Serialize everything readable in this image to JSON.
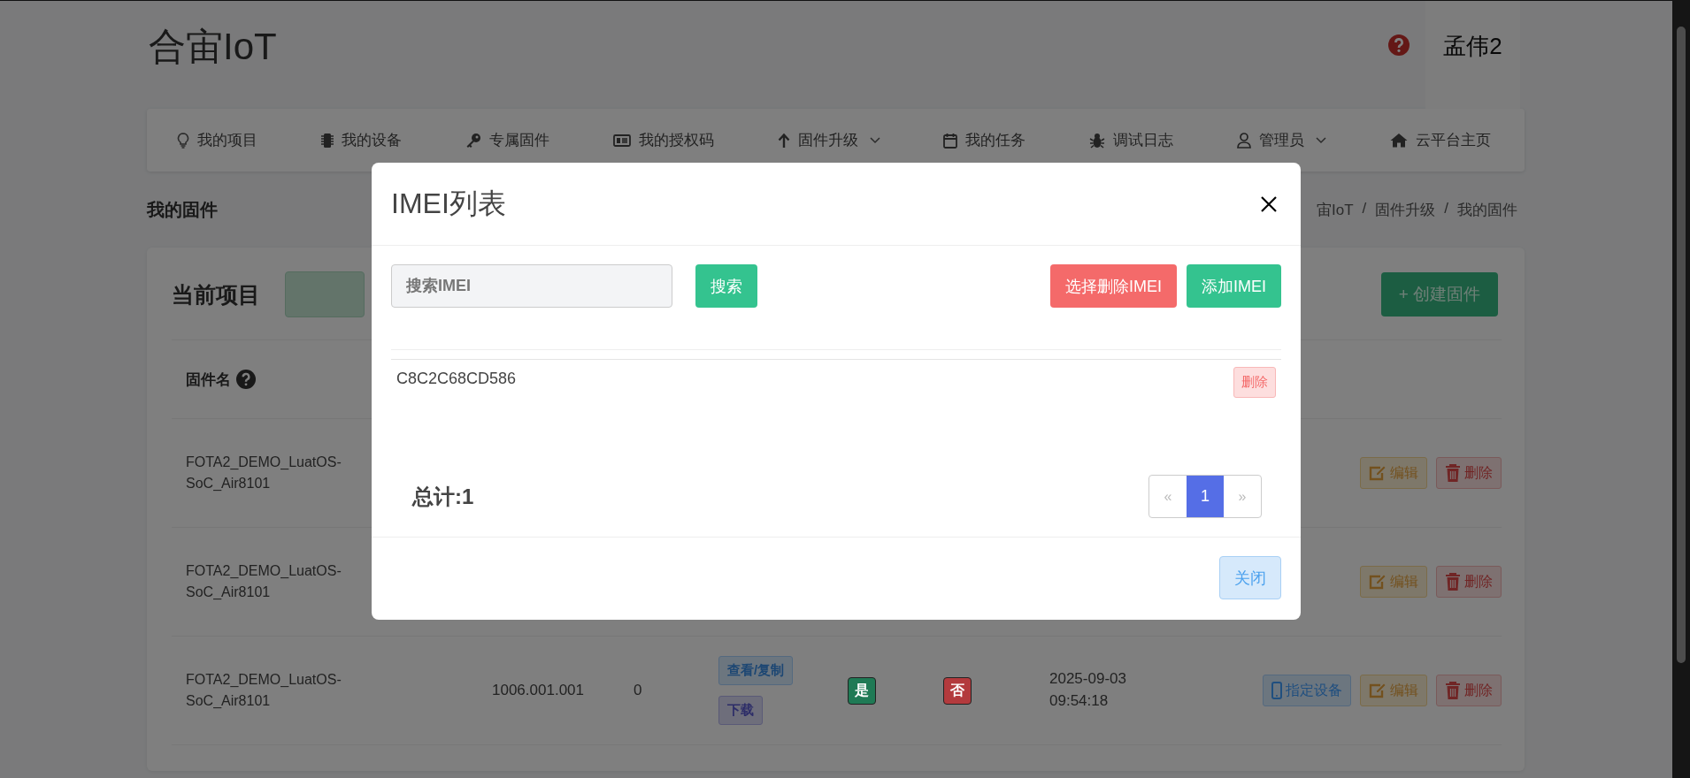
{
  "header": {
    "logo": "合宙IoT",
    "user": "孟伟2"
  },
  "nav": [
    {
      "label": "我的项目",
      "dropdown": false
    },
    {
      "label": "我的设备",
      "dropdown": false
    },
    {
      "label": "专属固件",
      "dropdown": false
    },
    {
      "label": "我的授权码",
      "dropdown": false
    },
    {
      "label": "固件升级",
      "dropdown": true
    },
    {
      "label": "我的任务",
      "dropdown": false
    },
    {
      "label": "调试日志",
      "dropdown": false
    },
    {
      "label": "管理员",
      "dropdown": true
    },
    {
      "label": "云平台主页",
      "dropdown": false
    }
  ],
  "breadcrumb": {
    "title": "我的固件",
    "trail": [
      "宙IoT",
      "/",
      "固件升级",
      "/",
      "我的固件"
    ]
  },
  "card": {
    "title": "当前项目",
    "create_button": "+ 创建固件"
  },
  "table": {
    "columns": [
      "固件名"
    ],
    "rows": [
      {
        "name": "FOTA2_DEMO_LuatOS-SoC_Air8101",
        "actions": [
          {
            "kind": "edit",
            "label": "编辑"
          },
          {
            "kind": "delete",
            "label": "删除"
          }
        ]
      },
      {
        "name": "FOTA2_DEMO_LuatOS-SoC_Air8101",
        "actions": [
          {
            "kind": "edit",
            "label": "编辑"
          },
          {
            "kind": "delete",
            "label": "删除"
          }
        ]
      },
      {
        "name": "FOTA2_DEMO_LuatOS-SoC_Air8101",
        "version": "1006.001.001",
        "count": "0",
        "buttons": [
          {
            "kind": "view",
            "label": "查看/复制"
          },
          {
            "kind": "download",
            "label": "下载"
          }
        ],
        "flags": [
          {
            "text": "是",
            "color": "#1f7a55"
          },
          {
            "text": "否",
            "color": "#b33a3d"
          }
        ],
        "time": "2025-09-03 09:54:18",
        "actions": [
          {
            "kind": "assign",
            "label": "指定设备"
          },
          {
            "kind": "edit",
            "label": "编辑"
          },
          {
            "kind": "delete",
            "label": "删除"
          }
        ]
      }
    ]
  },
  "modal": {
    "title": "IMEI列表",
    "search_placeholder": "搜索IMEI",
    "search_button": "搜索",
    "delete_selected_button": "选择删除IMEI",
    "add_button": "添加IMEI",
    "items": [
      {
        "imei": "C8C2C68CD586",
        "delete_button": "删除"
      }
    ],
    "total": "总计:1",
    "pagination": {
      "prev": "«",
      "pages": [
        {
          "label": "1",
          "selected": true
        }
      ],
      "next": "»"
    },
    "close_button": "关闭"
  }
}
